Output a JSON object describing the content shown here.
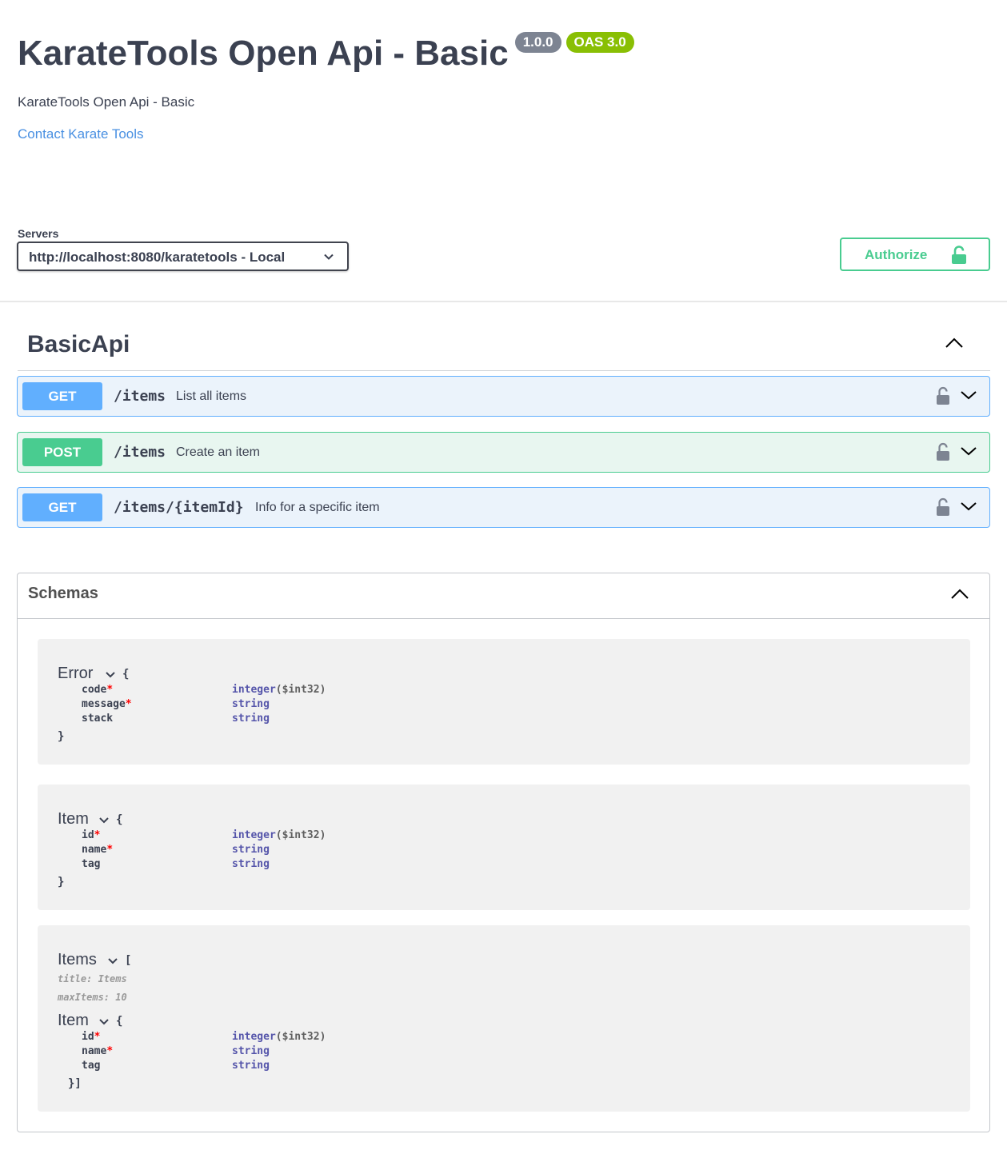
{
  "info": {
    "title": "KarateTools Open Api - Basic",
    "version": "1.0.0",
    "oas": "OAS 3.0",
    "description": "KarateTools Open Api - Basic",
    "contact_label": "Contact Karate Tools"
  },
  "servers": {
    "label": "Servers",
    "selected": "http://localhost:8080/karatetools - Local"
  },
  "authorize": {
    "label": "Authorize",
    "icon": "unlocked-icon"
  },
  "tag": {
    "name": "BasicApi"
  },
  "operations": [
    {
      "method": "GET",
      "path": "/items",
      "summary": "List all items"
    },
    {
      "method": "POST",
      "path": "/items",
      "summary": "Create an item"
    },
    {
      "method": "GET",
      "path": "/items/{itemId}",
      "summary": "Info for a specific item"
    }
  ],
  "schemas": {
    "title": "Schemas",
    "models": [
      {
        "name": "Error",
        "open": "{",
        "close": "}",
        "properties": [
          {
            "name": "code",
            "required": true,
            "type": "integer",
            "format": "($int32)"
          },
          {
            "name": "message",
            "required": true,
            "type": "string",
            "format": ""
          },
          {
            "name": "stack",
            "required": false,
            "type": "string",
            "format": ""
          }
        ]
      },
      {
        "name": "Item",
        "open": "{",
        "close": "}",
        "properties": [
          {
            "name": "id",
            "required": true,
            "type": "integer",
            "format": "($int32)"
          },
          {
            "name": "name",
            "required": true,
            "type": "string",
            "format": ""
          },
          {
            "name": "tag",
            "required": false,
            "type": "string",
            "format": ""
          }
        ]
      },
      {
        "name": "Items",
        "open": "[",
        "meta_title": "title: Items",
        "meta_max": "maxItems: 10",
        "inner": {
          "name": "Item",
          "open": "{",
          "close": "}]",
          "properties": [
            {
              "name": "id",
              "required": true,
              "type": "integer",
              "format": "($int32)"
            },
            {
              "name": "name",
              "required": true,
              "type": "string",
              "format": ""
            },
            {
              "name": "tag",
              "required": false,
              "type": "string",
              "format": ""
            }
          ]
        }
      }
    ]
  },
  "colors": {
    "get": "#61affe",
    "post": "#49cc90",
    "link": "#4990e2",
    "version_badge": "#7d8492",
    "oas_badge": "#89bf04"
  }
}
